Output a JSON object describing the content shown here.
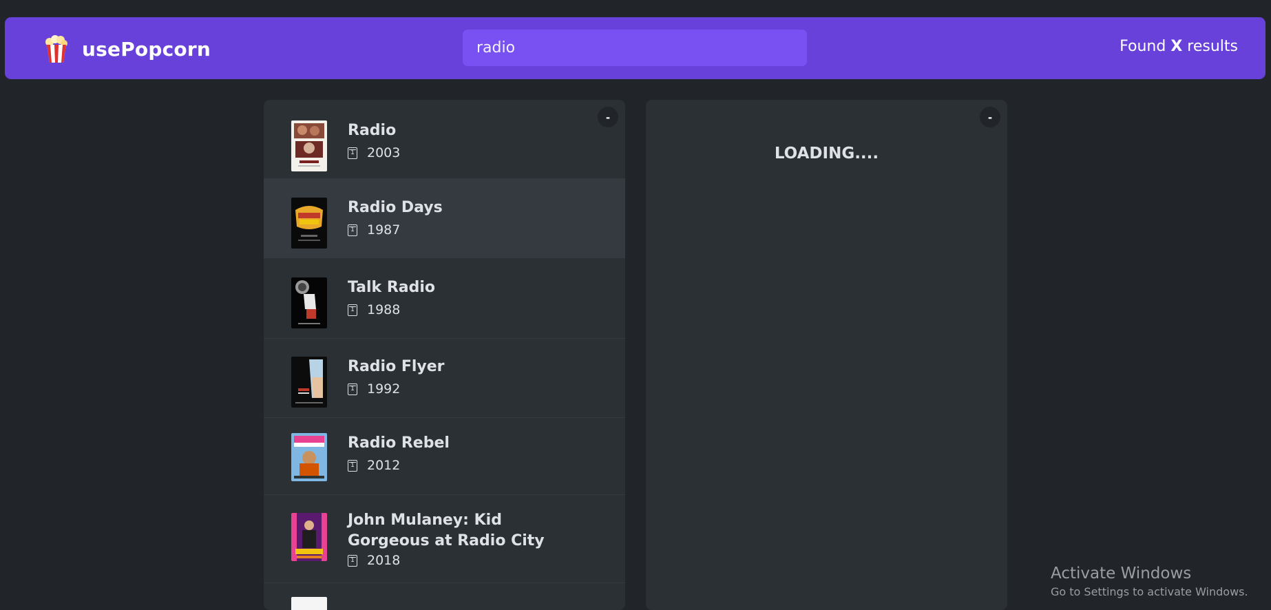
{
  "app": {
    "name": "usePopcorn",
    "logo_icon": "popcorn-icon"
  },
  "search": {
    "value": "radio",
    "placeholder": "Search movies..."
  },
  "results": {
    "prefix": "Found ",
    "count": "X",
    "suffix": " results"
  },
  "list_toggle": "-",
  "details_toggle": "-",
  "movies": [
    {
      "title": "Radio",
      "year": "2003"
    },
    {
      "title": "Radio Days",
      "year": "1987"
    },
    {
      "title": "Talk Radio",
      "year": "1988"
    },
    {
      "title": "Radio Flyer",
      "year": "1992"
    },
    {
      "title": "Radio Rebel",
      "year": "2012"
    },
    {
      "title": "John Mulaney: Kid Gorgeous at Radio City",
      "year": "2018"
    }
  ],
  "calendar_icon_glyph": "1",
  "details": {
    "loading": "LOADING...."
  },
  "watermark": {
    "line1": "Activate Windows",
    "line2": "Go to Settings to activate Windows."
  },
  "colors": {
    "primary": "#6741d9",
    "primary_light": "#7950f2",
    "background": "#212529",
    "box": "#2b3035"
  }
}
